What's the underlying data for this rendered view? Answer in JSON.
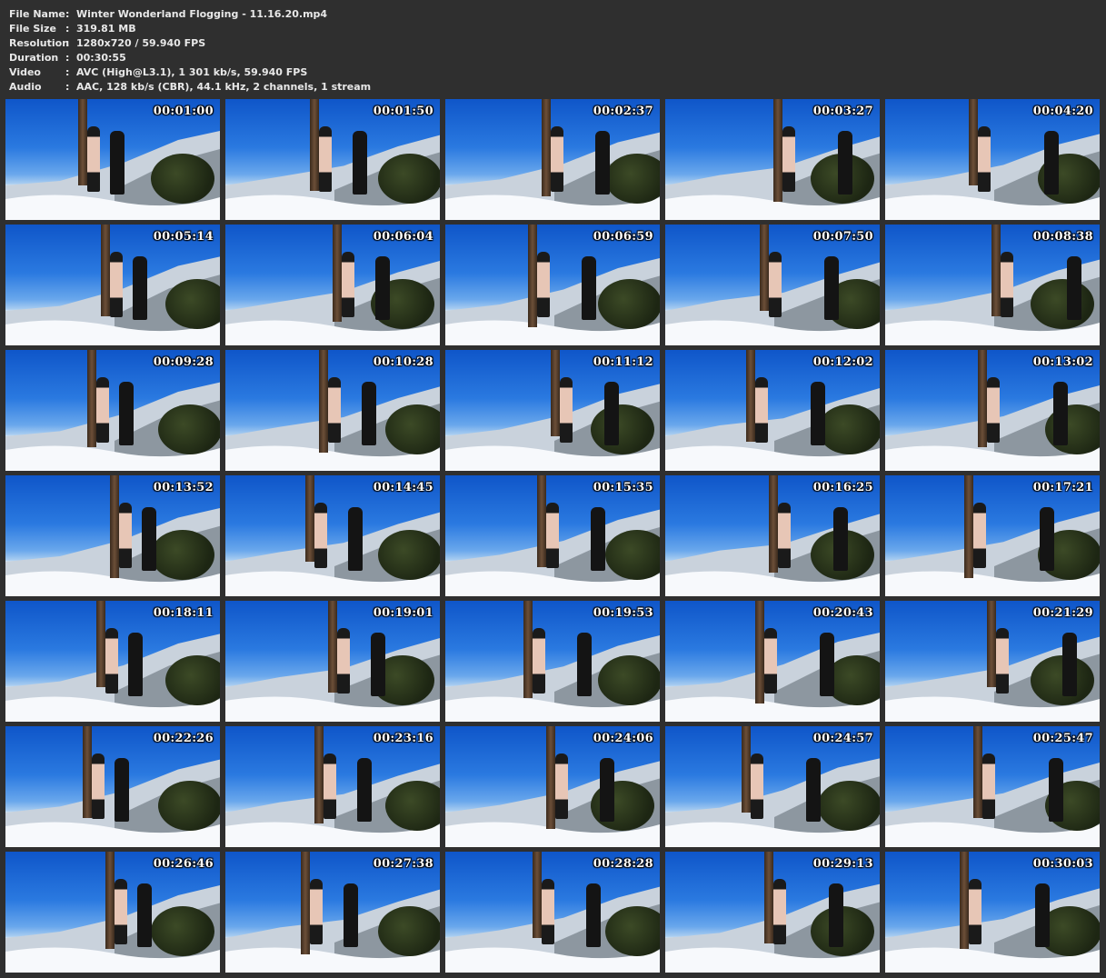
{
  "info": [
    {
      "label": "File Name",
      "value": "Winter Wonderland Flogging - 11.16.20.mp4"
    },
    {
      "label": "File Size",
      "value": "319.81 MB"
    },
    {
      "label": "Resolution",
      "value": "1280x720 / 59.940 FPS"
    },
    {
      "label": "Duration",
      "value": "00:30:55"
    },
    {
      "label": "Video",
      "value": "AVC (High@L3.1), 1 301 kb/s, 59.940 FPS"
    },
    {
      "label": "Audio",
      "value": "AAC, 128 kb/s (CBR), 44.1 kHz, 2 channels, 1 stream"
    }
  ],
  "separator": ":",
  "thumbnails": [
    "00:01:00",
    "00:01:50",
    "00:02:37",
    "00:03:27",
    "00:04:20",
    "00:05:14",
    "00:06:04",
    "00:06:59",
    "00:07:50",
    "00:08:38",
    "00:09:28",
    "00:10:28",
    "00:11:12",
    "00:12:02",
    "00:13:02",
    "00:13:52",
    "00:14:45",
    "00:15:35",
    "00:16:25",
    "00:17:21",
    "00:18:11",
    "00:19:01",
    "00:19:53",
    "00:20:43",
    "00:21:29",
    "00:22:26",
    "00:23:16",
    "00:24:06",
    "00:24:57",
    "00:25:47",
    "00:26:46",
    "00:27:38",
    "00:28:28",
    "00:29:13",
    "00:30:03"
  ]
}
